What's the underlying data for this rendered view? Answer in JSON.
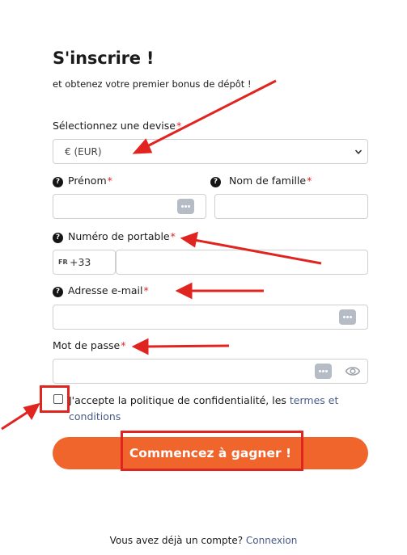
{
  "header": {
    "title": "S'inscrire !",
    "subtitle": "et obtenez votre premier bonus de dépôt !"
  },
  "currency": {
    "label": "Sélectionnez une devise",
    "required_mark": "*",
    "selected": "€ (EUR)"
  },
  "first_name": {
    "label": "Prénom",
    "required_mark": "*",
    "help_icon": "?"
  },
  "last_name": {
    "label": "Nom de famille",
    "required_mark": "*",
    "help_icon": "?"
  },
  "phone": {
    "label": "Numéro de portable",
    "required_mark": "*",
    "help_icon": "?",
    "country_code": "FR",
    "dial_code": "+33"
  },
  "email": {
    "label": "Adresse e-mail",
    "required_mark": "*",
    "help_icon": "?"
  },
  "password": {
    "label": "Mot de passe",
    "required_mark": "*"
  },
  "consent": {
    "text": "J'accepte la politique de confidentialité, les ",
    "link": "termes et conditions",
    "checked": false
  },
  "submit": {
    "label": "Commencez à gagner !"
  },
  "footer": {
    "text": "Vous avez déjà un compte? ",
    "link": "Connexion"
  },
  "colors": {
    "accent": "#f0652b",
    "required": "#e0242a",
    "link": "#485b87",
    "annotation": "#e0241f"
  },
  "icons": [
    "help-icon",
    "chevron-down-icon",
    "keyboard-dots-icon",
    "eye-icon",
    "annotation-arrow"
  ]
}
